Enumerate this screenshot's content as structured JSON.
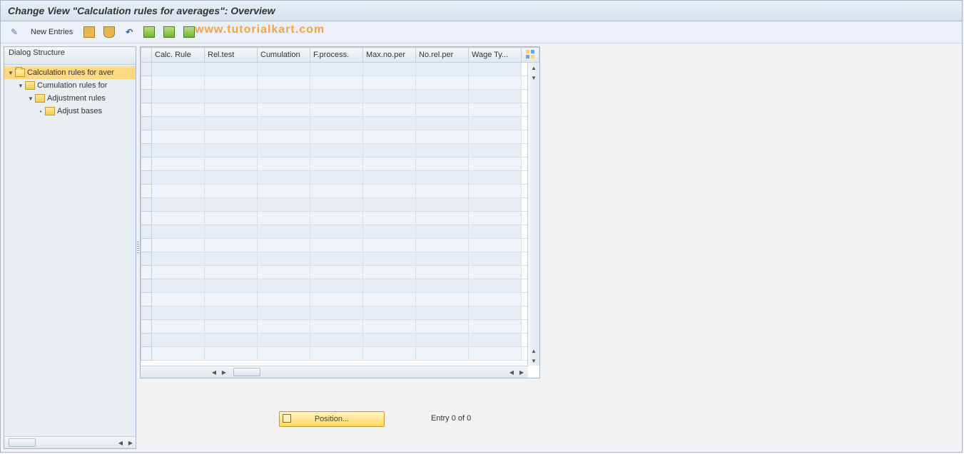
{
  "title": "Change View \"Calculation rules for averages\": Overview",
  "watermark": "www.tutorialkart.com",
  "toolbar": {
    "new_entries": "New Entries"
  },
  "sidebar": {
    "header": "Dialog Structure",
    "tree": [
      {
        "label": "Calculation rules for aver",
        "level": 0,
        "open": true,
        "selected": true,
        "leaf": false
      },
      {
        "label": "Cumulation rules for",
        "level": 1,
        "open": true,
        "selected": false,
        "leaf": false
      },
      {
        "label": "Adjustment rules",
        "level": 2,
        "open": true,
        "selected": false,
        "leaf": false
      },
      {
        "label": "Adjust bases",
        "level": 3,
        "open": false,
        "selected": false,
        "leaf": true
      }
    ]
  },
  "grid": {
    "columns": [
      "Calc. Rule",
      "Rel.test",
      "Cumulation",
      "F.process.",
      "Max.no.per",
      "No.rel.per",
      "Wage Ty..."
    ],
    "row_count": 22
  },
  "footer": {
    "position_btn": "Position...",
    "entry_text": "Entry 0 of 0"
  }
}
